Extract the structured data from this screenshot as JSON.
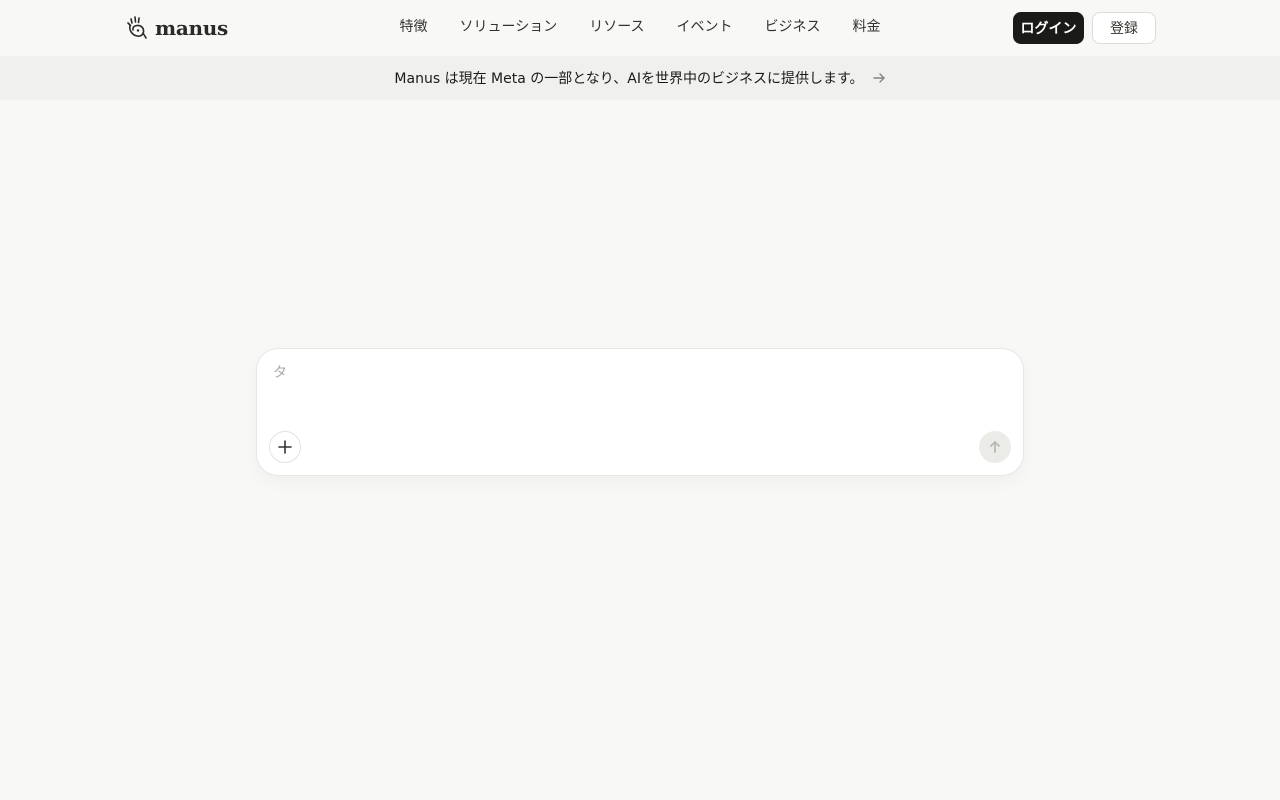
{
  "brand": {
    "name": "manus"
  },
  "nav": {
    "items": [
      {
        "label": "特徴"
      },
      {
        "label": "ソリューション"
      },
      {
        "label": "リソース"
      },
      {
        "label": "イベント"
      },
      {
        "label": "ビジネス"
      },
      {
        "label": "料金"
      }
    ],
    "login_label": "ログイン",
    "signup_label": "登録"
  },
  "banner": {
    "text": "Manus は現在 Meta の一部となり、AIを世界中のビジネスに提供します。",
    "icon": "arrow-right-icon"
  },
  "composer": {
    "input_text": "タ",
    "add_icon": "plus-icon",
    "send_icon": "arrow-up-icon"
  },
  "colors": {
    "background": "#f8f8f6",
    "banner_background": "#f0f0ee",
    "login_button": "#1a1a19"
  }
}
